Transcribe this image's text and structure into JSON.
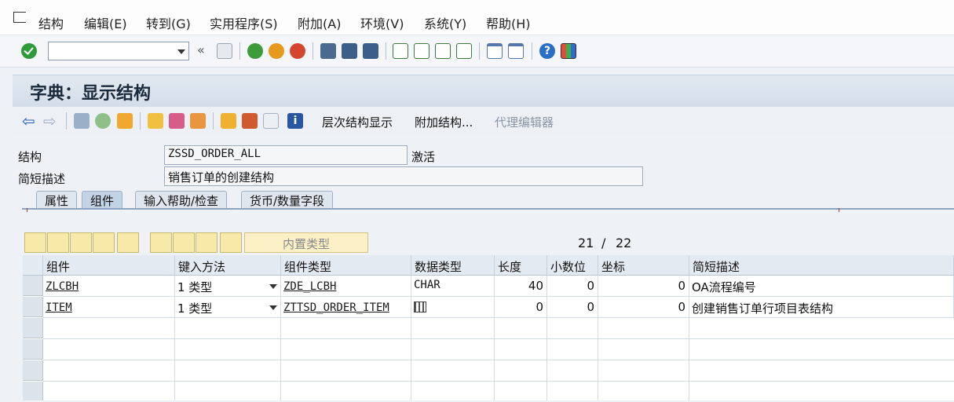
{
  "menu": [
    "结构",
    "编辑(E)",
    "转到(G)",
    "实用程序(S)",
    "附加(A)",
    "环境(V)",
    "系统(Y)",
    "帮助(H)"
  ],
  "title": "字典：显示结构",
  "app_toolbar": {
    "hierarchy_display": "层次结构显示",
    "append_structure": "附加结构...",
    "proxy_editor": "代理编辑器"
  },
  "form": {
    "structure_label": "结构",
    "structure_value": "ZSSD_ORDER_ALL",
    "status": "激活",
    "short_desc_label": "简短描述",
    "short_desc_value": "销售订单的创建结构"
  },
  "tabs": [
    "属性",
    "组件",
    "输入帮助/检查",
    "货币/数量字段"
  ],
  "active_tab": "组件",
  "table_toolbar": {
    "builtin_type": "内置类型",
    "counter_current": "21",
    "counter_sep": "/",
    "counter_total": "22"
  },
  "table": {
    "headers": [
      "组件",
      "键入方法",
      "组件类型",
      "数据类型",
      "长度",
      "小数位",
      "坐标",
      "简短描述"
    ],
    "rows": [
      {
        "component": "ZLCBH",
        "method": "1 类型",
        "type": "ZDE_LCBH",
        "datatype": "CHAR",
        "length": "40",
        "decimals": "0",
        "coord": "0",
        "desc": "OA流程编号"
      },
      {
        "component": "ITEM",
        "method": "1 类型",
        "type": "ZTTSD_ORDER_ITEM",
        "datatype": "",
        "length": "0",
        "decimals": "0",
        "coord": "0",
        "desc": "创建销售订单行项目表结构"
      }
    ]
  },
  "colors": {
    "accent": "#8ca4c0",
    "ok": "#2e9a3a",
    "help": "#2a6fc4"
  }
}
